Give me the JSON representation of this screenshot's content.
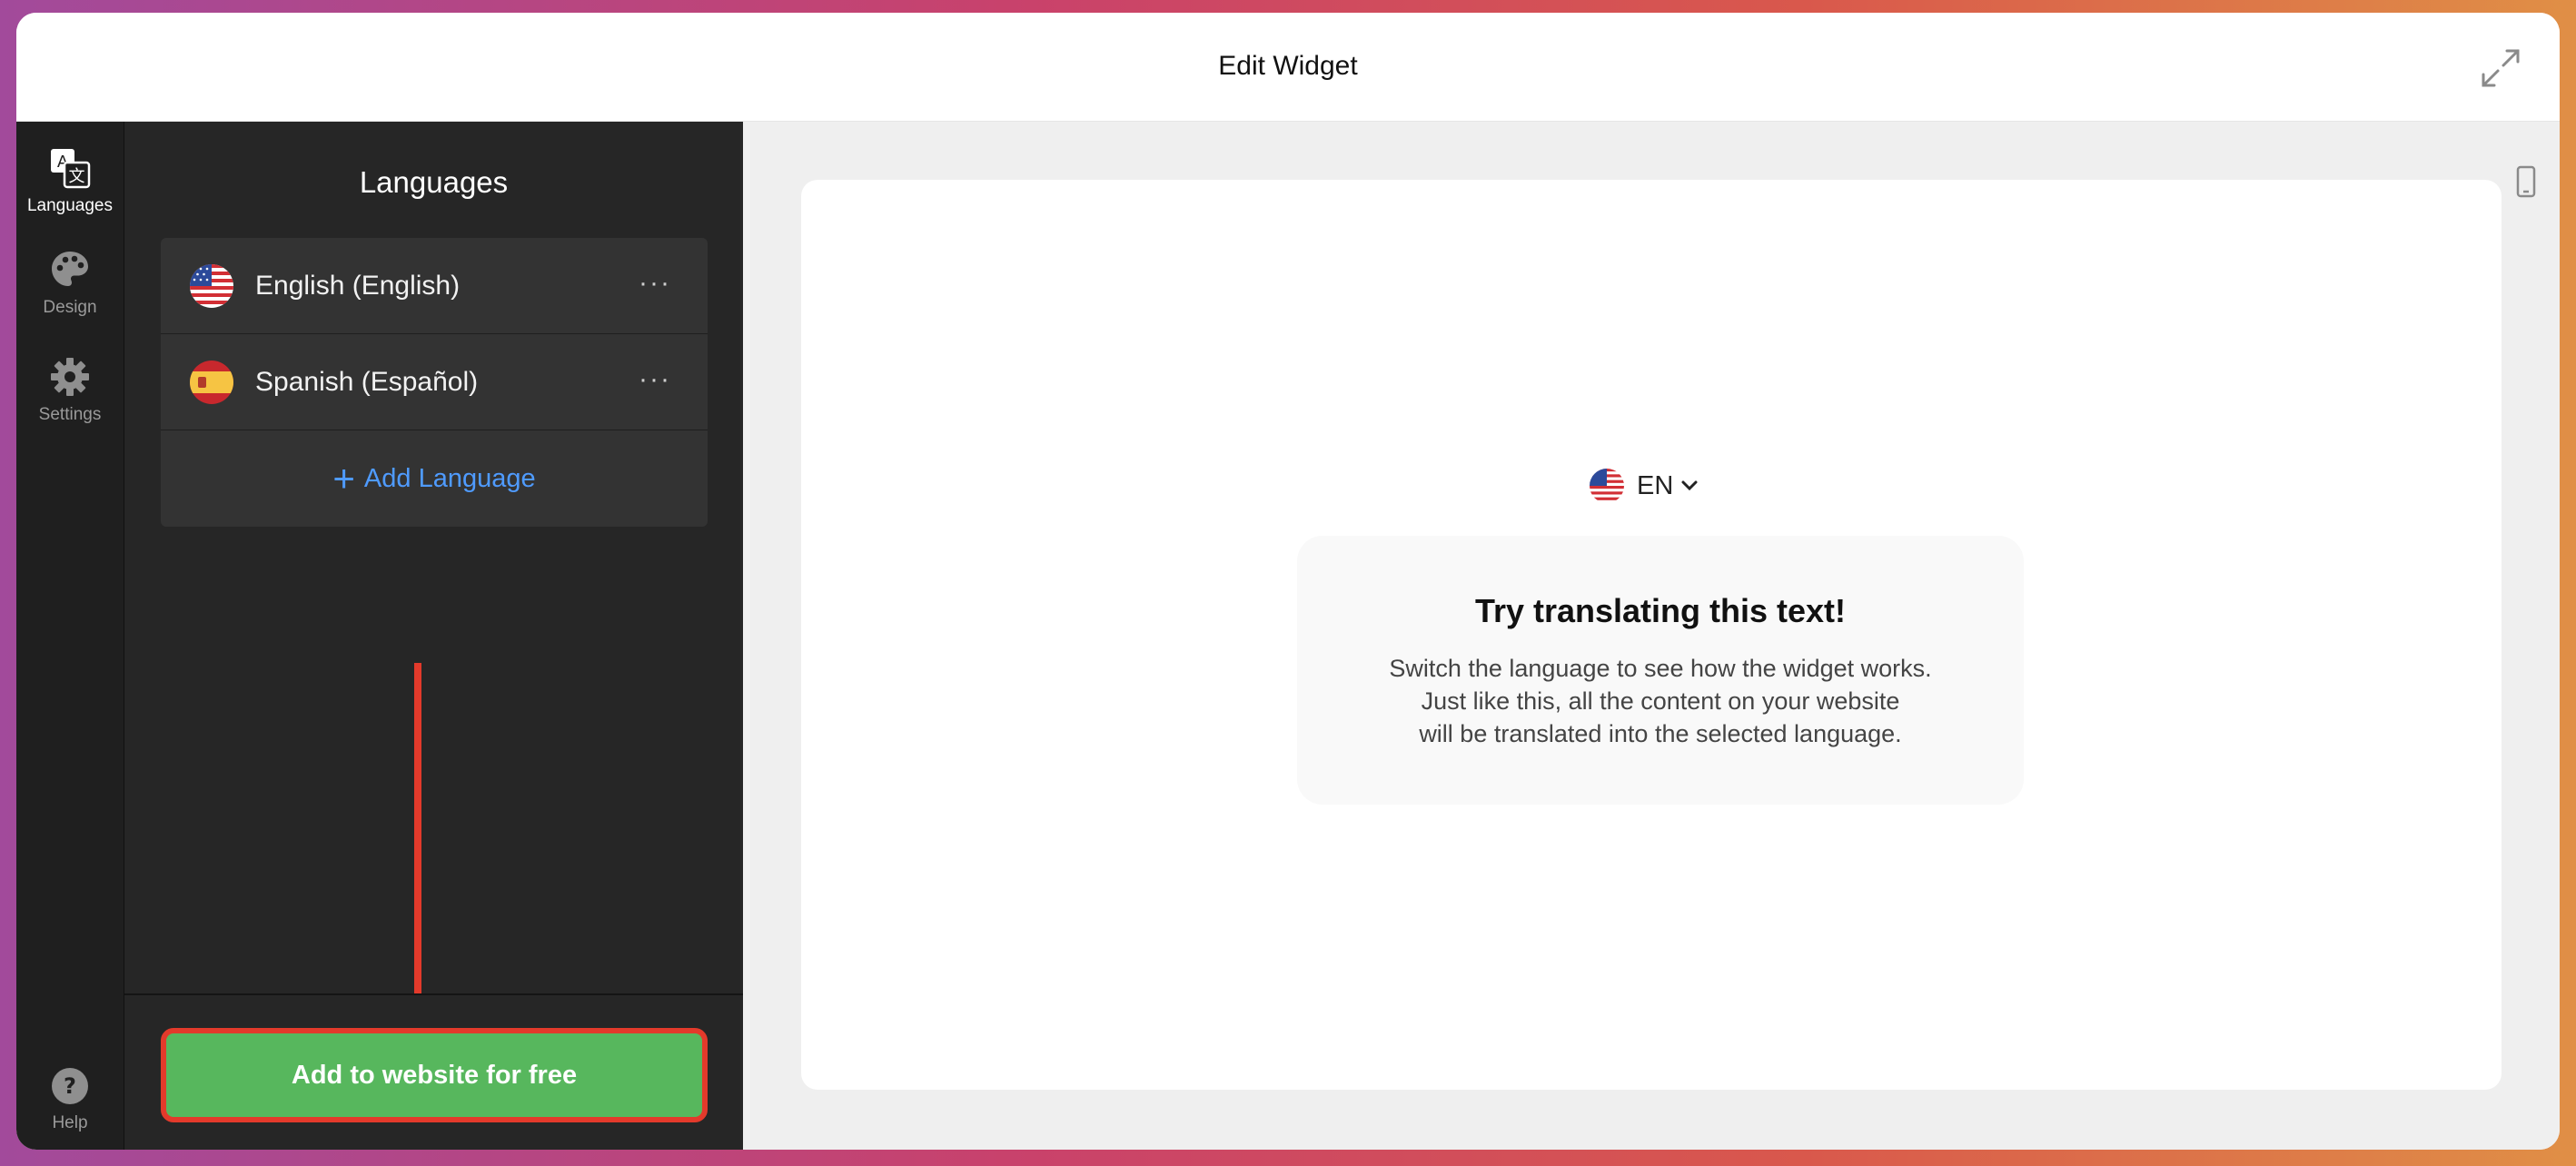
{
  "window": {
    "title": "Edit Widget"
  },
  "rail": {
    "items": [
      {
        "label": "Languages",
        "icon": "translate-icon",
        "active": true
      },
      {
        "label": "Design",
        "icon": "palette-icon",
        "active": false
      },
      {
        "label": "Settings",
        "icon": "gear-icon",
        "active": false
      }
    ],
    "help_label": "Help"
  },
  "panel": {
    "title": "Languages",
    "languages": [
      {
        "name": "English (English)",
        "flag": "us-flag-icon"
      },
      {
        "name": "Spanish (Español)",
        "flag": "es-flag-icon"
      }
    ],
    "more_glyph": "···",
    "add_language_label": "Add Language",
    "cta_label": "Add to website for free"
  },
  "preview": {
    "switcher_code": "EN",
    "card_title": "Try translating this text!",
    "card_lines": [
      "Switch the language to see how the widget works.",
      "Just like this, all the content on your website",
      "will be translated into the selected language."
    ]
  },
  "colors": {
    "accent_blue": "#4f9bff",
    "cta_green": "#57b75d",
    "highlight_red": "#e33a2b"
  }
}
